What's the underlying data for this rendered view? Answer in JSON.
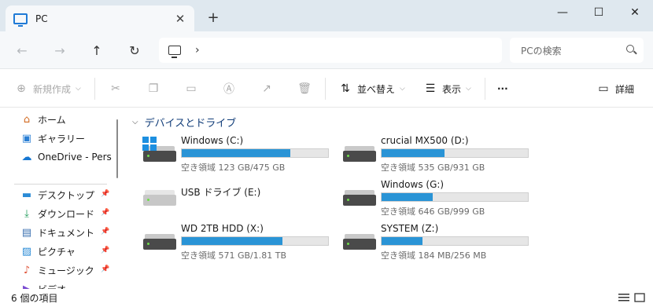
{
  "window": {
    "tab_title": "PC",
    "tab_close": "✕",
    "new_tab": "+",
    "minimize": "—",
    "maximize": "☐",
    "close": "✕"
  },
  "navbar": {
    "back": "←",
    "forward": "→",
    "up": "↑",
    "refresh": "↻",
    "address_chevron": "›",
    "search_placeholder": "PCの検索"
  },
  "commands": {
    "new": "新規作成",
    "sort": "並べ替え",
    "view": "表示",
    "more": "···",
    "details": "詳細"
  },
  "sidebar": {
    "items": [
      {
        "label": "ホーム",
        "icon": "home-icon"
      },
      {
        "label": "ギャラリー",
        "icon": "gallery-icon"
      },
      {
        "label": "OneDrive - Personal",
        "icon": "onedrive-icon"
      },
      {
        "label": "デスクトップ",
        "icon": "desktop-icon"
      },
      {
        "label": "ダウンロード",
        "icon": "download-icon"
      },
      {
        "label": "ドキュメント",
        "icon": "document-icon"
      },
      {
        "label": "ピクチャ",
        "icon": "pictures-icon"
      },
      {
        "label": "ミュージック",
        "icon": "music-icon"
      },
      {
        "label": "ビデオ",
        "icon": "video-icon"
      }
    ]
  },
  "main": {
    "group_title": "デバイスとドライブ",
    "drives": [
      {
        "name": "Windows (C:)",
        "space": "空き領域 123 GB/475 GB",
        "used_fraction": 0.74,
        "type": "system"
      },
      {
        "name": "crucial MX500 (D:)",
        "space": "空き領域 535 GB/931 GB",
        "used_fraction": 0.43,
        "type": "hdd"
      },
      {
        "name": "USB ドライブ (E:)",
        "space": "",
        "used_fraction": null,
        "type": "usb"
      },
      {
        "name": "Windows (G:)",
        "space": "空き領域 646 GB/999 GB",
        "used_fraction": 0.35,
        "type": "hdd"
      },
      {
        "name": "WD 2TB HDD (X:)",
        "space": "空き領域 571 GB/1.81 TB",
        "used_fraction": 0.69,
        "type": "hdd"
      },
      {
        "name": "SYSTEM (Z:)",
        "space": "空き領域 184 MB/256 MB",
        "used_fraction": 0.28,
        "type": "hdd"
      }
    ]
  },
  "statusbar": {
    "item_count": "6 個の項目"
  },
  "colors": {
    "accent": "#2a94d6",
    "titlebar": "#dfe8ef",
    "group_title": "#103c78"
  }
}
